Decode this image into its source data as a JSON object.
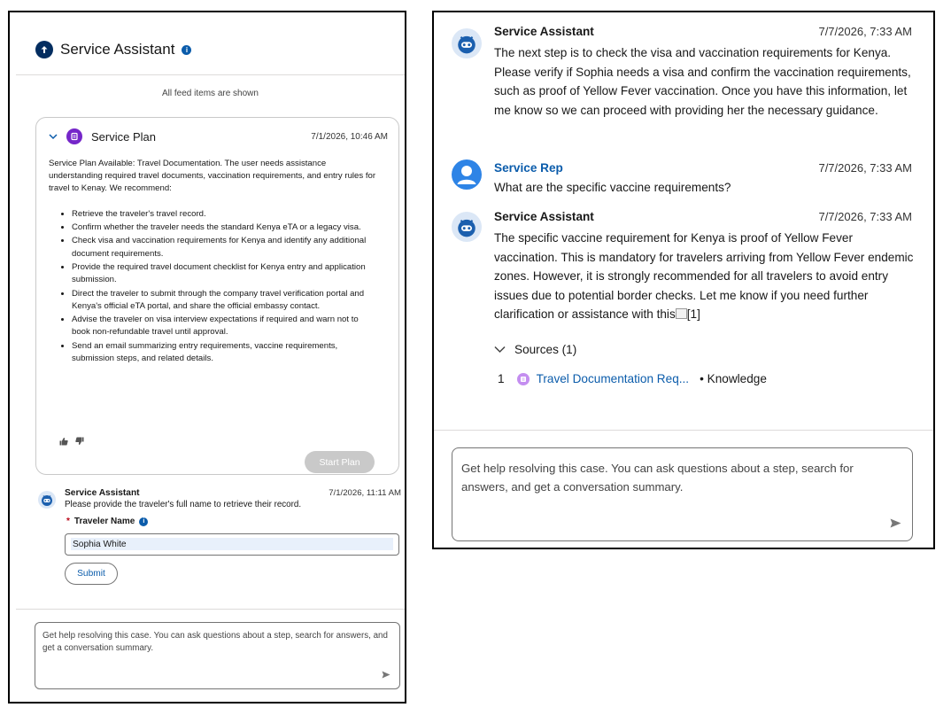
{
  "left": {
    "header": {
      "title": "Service Assistant",
      "info": "i"
    },
    "feed_note": "All feed items are shown",
    "plan": {
      "title": "Service Plan",
      "time": "7/1/2026, 10:46 AM",
      "summary": "Service Plan Available: Travel Documentation. The user needs assistance understanding required travel documents, vaccination requirements, and entry rules for travel to Kenay. We recommend:",
      "steps": [
        "Retrieve the traveler's travel record.",
        "Confirm whether the traveler needs the standard Kenya eTA or a legacy visa.",
        "Check visa and vaccination requirements for Kenya and identify any additional document requirements.",
        "Provide the required travel document checklist for Kenya entry and application submission.",
        "Direct the traveler to submit through the company travel verification portal and Kenya's official eTA portal, and share the official embassy contact.",
        "Advise the traveler on visa interview expectations if required and warn not to book non-refundable travel until approval.",
        "Send an email summarizing entry requirements, vaccine requirements, submission steps, and related details."
      ],
      "start_label": "Start Plan"
    },
    "assistant_msg": {
      "name": "Service Assistant",
      "time": "7/1/2026, 11:11 AM",
      "text": "Please provide the traveler's full name to retrieve their record.",
      "field_required": "*",
      "field_label": "Traveler Name",
      "field_value": "Sophia White",
      "submit_label": "Submit"
    },
    "composer_placeholder": "Get help resolving this case. You can ask questions about a step, search for answers, and get a conversation summary."
  },
  "right": {
    "messages": [
      {
        "name": "Service Assistant",
        "time": "7/7/2026, 7:33 AM",
        "text": "The next step is to check the visa and vaccination requirements for Kenya. Please verify if Sophia needs a visa and confirm the vaccination requirements, such as proof of Yellow Fever vaccination. Once you have this information, let me know so we can proceed with providing her the necessary guidance."
      },
      {
        "name": "Service Rep",
        "time": "7/7/2026, 7:33 AM",
        "text": "What are the specific vaccine requirements?"
      },
      {
        "name": "Service Assistant",
        "time": "7/7/2026, 7:33 AM",
        "text": "The specific vaccine requirement for Kenya is proof of Yellow Fever vaccination. This is mandatory for travelers arriving from Yellow Fever endemic zones. However, it is strongly recommended for all travelers to avoid entry issues due to potential border checks. Let me know if you need further clarification or assistance with this",
        "citation": "[1]"
      }
    ],
    "sources": {
      "label": "Sources (1)",
      "items": [
        {
          "num": "1",
          "title": "Travel Documentation Req...",
          "type": "• Knowledge"
        }
      ]
    },
    "composer_placeholder": "Get help resolving this case. You can ask questions about a step, search for answers, and get a conversation summary."
  },
  "colors": {
    "accent": "#0b5cab",
    "plan_purple": "#7526c9",
    "navy": "#032d60"
  },
  "icons": {
    "thumbs": [
      "thumbs-up-icon",
      "thumbs-down-icon"
    ],
    "send": "send-icon",
    "chevron": "chevron-down-icon"
  }
}
